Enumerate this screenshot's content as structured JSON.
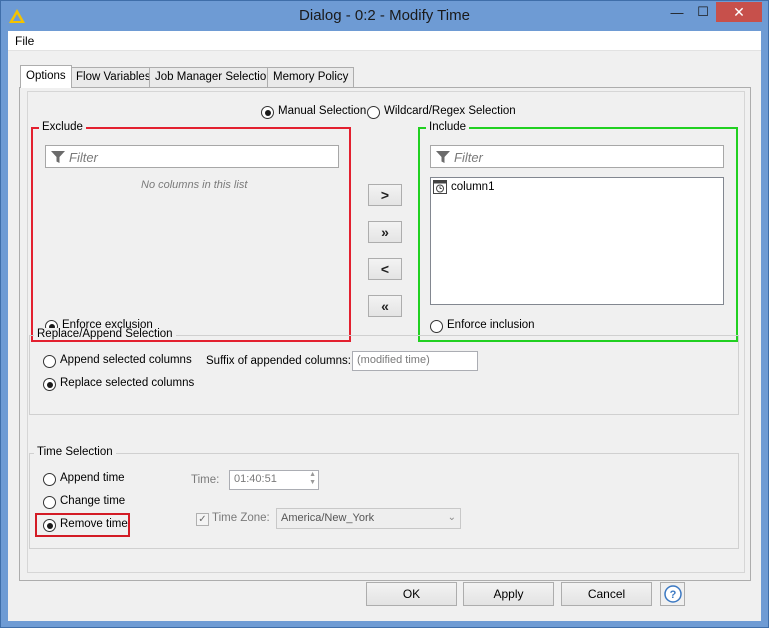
{
  "window": {
    "title": "Dialog - 0:2 - Modify Time",
    "minimize_glyph": "—",
    "maximize_glyph": "☐",
    "close_glyph": "✕"
  },
  "menu": {
    "file": "File"
  },
  "tabs": [
    {
      "label": "Options",
      "active": true
    },
    {
      "label": "Flow Variables",
      "active": false
    },
    {
      "label": "Job Manager Selection",
      "active": false
    },
    {
      "label": "Memory Policy",
      "active": false
    }
  ],
  "column_selection": {
    "mode_options": [
      "Manual Selection",
      "Wildcard/Regex Selection"
    ],
    "selected_mode": "Manual Selection",
    "exclude": {
      "title": "Exclude",
      "filter_placeholder": "Filter",
      "empty_message": "No columns in this list",
      "enforce_label": "Enforce exclusion",
      "enforce_selected": true,
      "border_color": "#e3202f"
    },
    "include": {
      "title": "Include",
      "filter_placeholder": "Filter",
      "items": [
        "column1"
      ],
      "enforce_label": "Enforce inclusion",
      "enforce_selected": false,
      "border_color": "#21d021"
    },
    "move_buttons": {
      "add": ">",
      "add_all": "»",
      "remove": "<",
      "remove_all": "«"
    }
  },
  "replace_append": {
    "title": "Replace/Append Selection",
    "options": [
      "Append selected columns",
      "Replace selected columns"
    ],
    "selected": "Replace selected columns",
    "suffix_label": "Suffix of appended columns:",
    "suffix_value": "(modified time)"
  },
  "time_selection": {
    "title": "Time Selection",
    "options": [
      "Append time",
      "Change time",
      "Remove time"
    ],
    "selected": "Remove time",
    "time_label": "Time:",
    "time_value": "01:40:51",
    "time_zone_label": "Time Zone:",
    "time_zone_checked": true,
    "time_zone_value": "America/New_York",
    "highlight_color": "#d31b25"
  },
  "footer": {
    "ok": "OK",
    "apply": "Apply",
    "cancel": "Cancel",
    "help_glyph": "?"
  },
  "icons": {
    "app": "knime-triangle-icon",
    "filter": "funnel-icon",
    "column_type": "time-column-icon",
    "help": "help-icon"
  }
}
